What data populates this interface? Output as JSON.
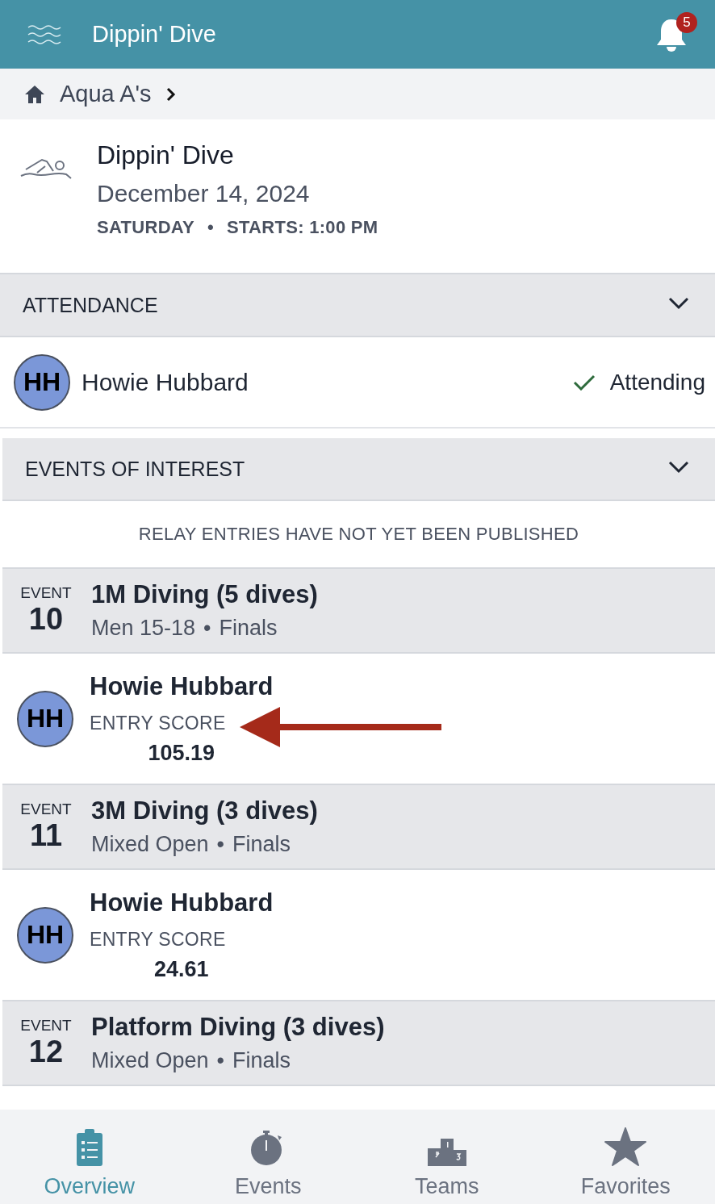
{
  "header": {
    "title": "Dippin' Dive",
    "notification_count": "5"
  },
  "breadcrumb": {
    "label": "Aqua A's"
  },
  "meet": {
    "name": "Dippin' Dive",
    "date": "December 14, 2024",
    "day": "SATURDAY",
    "separator": "•",
    "starts": "STARTS: 1:00 PM"
  },
  "attendance": {
    "title": "ATTENDANCE",
    "expanded": true,
    "athletes": [
      {
        "initials": "HH",
        "name": "Howie Hubbard",
        "status": "Attending"
      }
    ]
  },
  "events_of_interest": {
    "title": "EVENTS OF INTEREST",
    "expanded": true,
    "note": "RELAY ENTRIES HAVE NOT YET BEEN PUBLISHED",
    "events": [
      {
        "event_label": "EVENT",
        "number": "10",
        "name": "1M Diving (5 dives)",
        "group": "Men 15-18",
        "separator": "•",
        "round": "Finals",
        "entries": [
          {
            "initials": "HH",
            "name": "Howie Hubbard",
            "score_label": "ENTRY SCORE",
            "score": "105.19",
            "arrow": true
          }
        ]
      },
      {
        "event_label": "EVENT",
        "number": "11",
        "name": "3M Diving (3 dives)",
        "group": "Mixed Open",
        "separator": "•",
        "round": "Finals",
        "entries": [
          {
            "initials": "HH",
            "name": "Howie Hubbard",
            "score_label": "ENTRY SCORE",
            "score": "24.61",
            "arrow": false
          }
        ]
      },
      {
        "event_label": "EVENT",
        "number": "12",
        "name": "Platform Diving (3 dives)",
        "group": "Mixed Open",
        "separator": "•",
        "round": "Finals"
      }
    ]
  },
  "tabs": [
    {
      "label": "Overview",
      "kind": "overview",
      "selected": true
    },
    {
      "label": "Events",
      "kind": "events",
      "selected": false
    },
    {
      "label": "Teams",
      "kind": "teams",
      "selected": false
    },
    {
      "label": "Favorites",
      "kind": "favorites",
      "selected": false
    }
  ]
}
